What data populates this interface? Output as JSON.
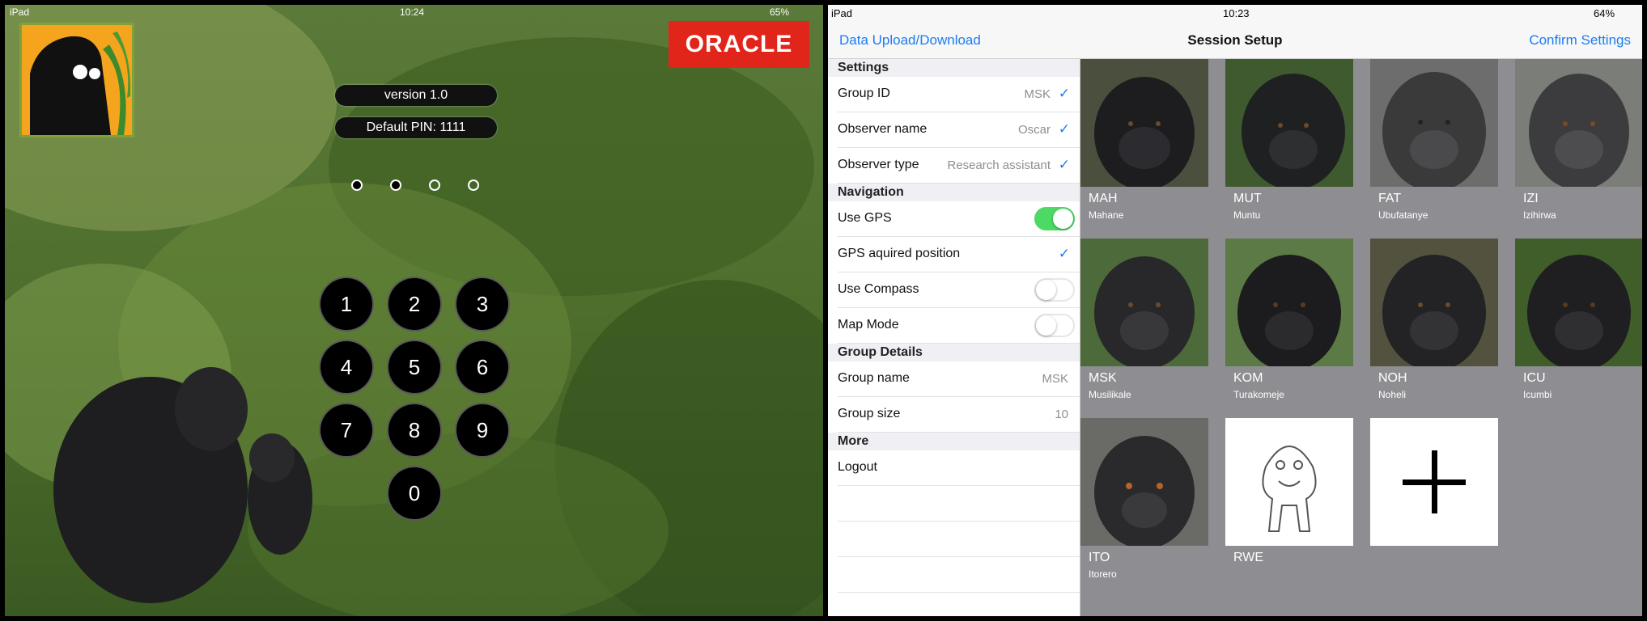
{
  "left": {
    "status_left": "iPad",
    "status_time": "10:24",
    "status_battery": "65%",
    "brand": "ORACLE",
    "version_label": "version 1.0",
    "pin_label": "Default PIN: 1111",
    "pin_filled": 2,
    "pin_total": 4,
    "keys": [
      "1",
      "2",
      "3",
      "4",
      "5",
      "6",
      "7",
      "8",
      "9",
      "0"
    ]
  },
  "right": {
    "status_left": "iPad",
    "status_time": "10:23",
    "status_battery": "64%",
    "nav": {
      "left_button": "Data Upload/Download",
      "title": "Session Setup",
      "right_button": "Confirm Settings"
    },
    "settings": {
      "header": "Settings",
      "group_id": {
        "label": "Group ID",
        "value": "MSK"
      },
      "observer_name": {
        "label": "Observer name",
        "value": "Oscar"
      },
      "observer_type": {
        "label": "Observer type",
        "value": "Research assistant"
      }
    },
    "navigation": {
      "header": "Navigation",
      "use_gps": {
        "label": "Use GPS",
        "on": true
      },
      "gps_position": {
        "label": "GPS aquired position"
      },
      "use_compass": {
        "label": "Use Compass",
        "on": false
      },
      "map_mode": {
        "label": "Map Mode",
        "on": false
      }
    },
    "group_details": {
      "header": "Group Details",
      "group_name": {
        "label": "Group name",
        "value": "MSK"
      },
      "group_size": {
        "label": "Group size",
        "value": "10"
      }
    },
    "more": {
      "header": "More",
      "logout": "Logout"
    },
    "gorillas": [
      {
        "code": "MAH",
        "name": "Mahane"
      },
      {
        "code": "MUT",
        "name": "Muntu"
      },
      {
        "code": "FAT",
        "name": "Ubufatanye"
      },
      {
        "code": "IZI",
        "name": "Izihirwa"
      },
      {
        "code": "MSK",
        "name": "Musilikale"
      },
      {
        "code": "KOM",
        "name": "Turakomeje"
      },
      {
        "code": "NOH",
        "name": "Noheli"
      },
      {
        "code": "ICU",
        "name": "Icumbi"
      },
      {
        "code": "ITO",
        "name": "Itorero"
      },
      {
        "code": "RWE",
        "name": ""
      }
    ],
    "colors": {
      "accent": "#1b7cf4",
      "toggle_on": "#4cd964",
      "grid_bg": "#8e8e92"
    }
  }
}
